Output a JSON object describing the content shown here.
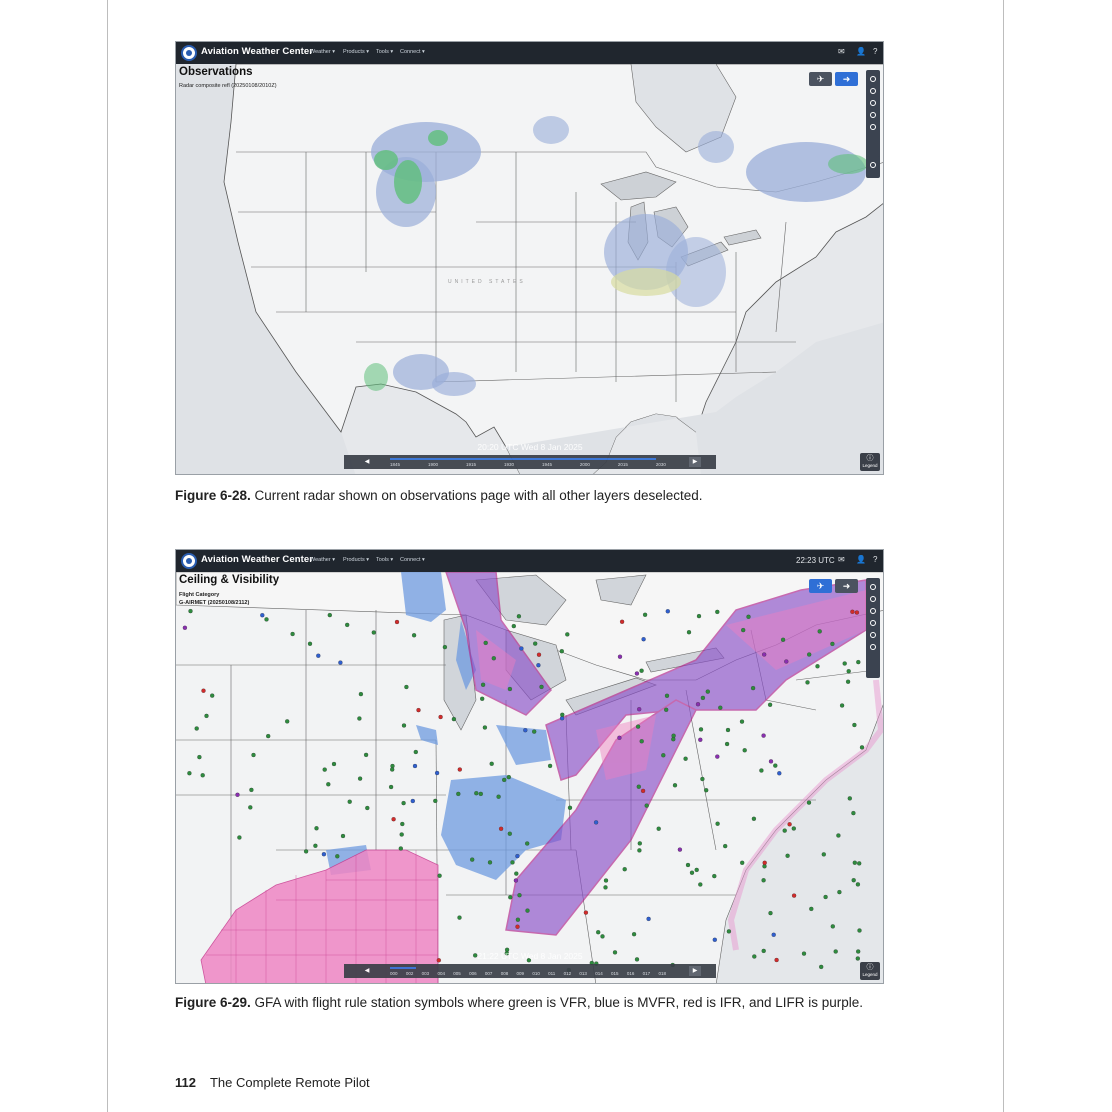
{
  "figure1": {
    "app_brand": "Aviation Weather Center",
    "menus": [
      "Weather ▾",
      "Products ▾",
      "Tools ▾",
      "Connect ▾"
    ],
    "map_title": "Observations",
    "map_subtitle": "Radar composite refl (20250108/2010Z)",
    "timestamp": "20:20 UTC Wed 8 Jan 2025",
    "timeline_ticks": [
      "1845",
      "1900",
      "1915",
      "1930",
      "1945",
      "2000",
      "2015",
      "2030"
    ],
    "country_label": "UNITED STATES",
    "legend_label": "Legend",
    "caption_label": "Figure 6-28.",
    "caption_text": " Current radar shown on observations page with all other layers deselected."
  },
  "figure2": {
    "app_brand": "Aviation Weather Center",
    "menus": [
      "Weather ▾",
      "Products ▾",
      "Tools ▾",
      "Connect ▾"
    ],
    "clock": "22:23 UTC",
    "map_title": "Ceiling & Visibility",
    "map_subtitle_1": "Flight Category",
    "map_subtitle_2": "G-AIRMET (20250108/2112)",
    "timestamp": "21:22 UTC Wed 8 Jan 2025",
    "timeline_ticks": [
      "000",
      "002",
      "003",
      "004",
      "005",
      "006",
      "007",
      "008",
      "009",
      "010",
      "011",
      "012",
      "013",
      "014",
      "015",
      "016",
      "017",
      "018"
    ],
    "legend_label": "Legend",
    "caption_label": "Figure 6-29.",
    "caption_text": " GFA with flight rule station symbols where green is VFR, blue is MVFR, red is IFR, and LIFR is purple."
  },
  "footer": {
    "page_number": "112",
    "book_title": "The Complete Remote Pilot"
  },
  "colors": {
    "vfr": "#2e8b3e",
    "mvfr": "#2f5fd0",
    "ifr": "#d22b2b",
    "lifr": "#8a2fb0",
    "airmet_ifr": "#8a4fc8",
    "airmet_mvfr": "#6f9be0",
    "winter_storm": "#ef86c4",
    "radar_light": "#9aaed8",
    "radar_green": "#5fbf7a"
  }
}
